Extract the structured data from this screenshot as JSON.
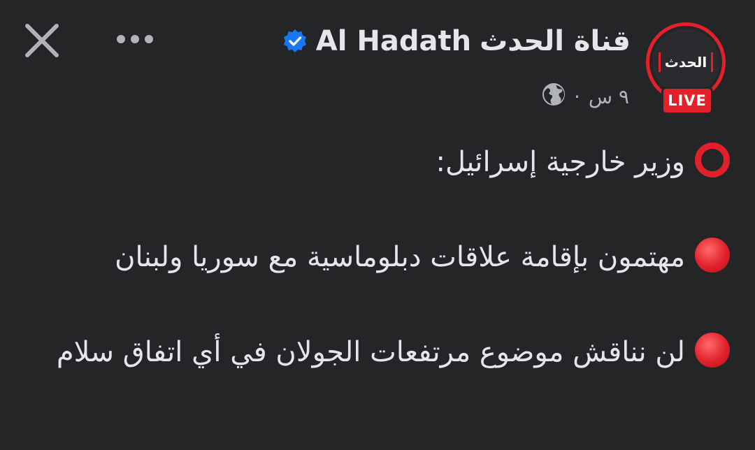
{
  "header": {
    "name_arabic": "قناة الحدث",
    "name_english": "Al Hadath",
    "verified": true,
    "avatar_logo_text": "الحدث",
    "live_badge": "LIVE",
    "time_ago": "٩ س",
    "separator": "·",
    "audience_icon": "globe-icon"
  },
  "toolbar": {
    "close_icon": "close-icon",
    "more_icon": "more-options-icon"
  },
  "post": {
    "lines": [
      {
        "bullet": "hollow-red-circle",
        "text": "وزير خارجية إسرائيل:"
      },
      {
        "bullet": "red-circle",
        "text": "مهتمون بإقامة علاقات دبلوماسية مع سوريا ولبنان"
      },
      {
        "bullet": "red-circle",
        "text": "لن نناقش موضوع مرتفعات الجولان في أي اتفاق سلام"
      }
    ]
  },
  "colors": {
    "background": "#242526",
    "text": "#e4e6eb",
    "secondary_text": "#b0b3b8",
    "accent_red": "#e4202a",
    "verified_blue": "#1877f2"
  }
}
